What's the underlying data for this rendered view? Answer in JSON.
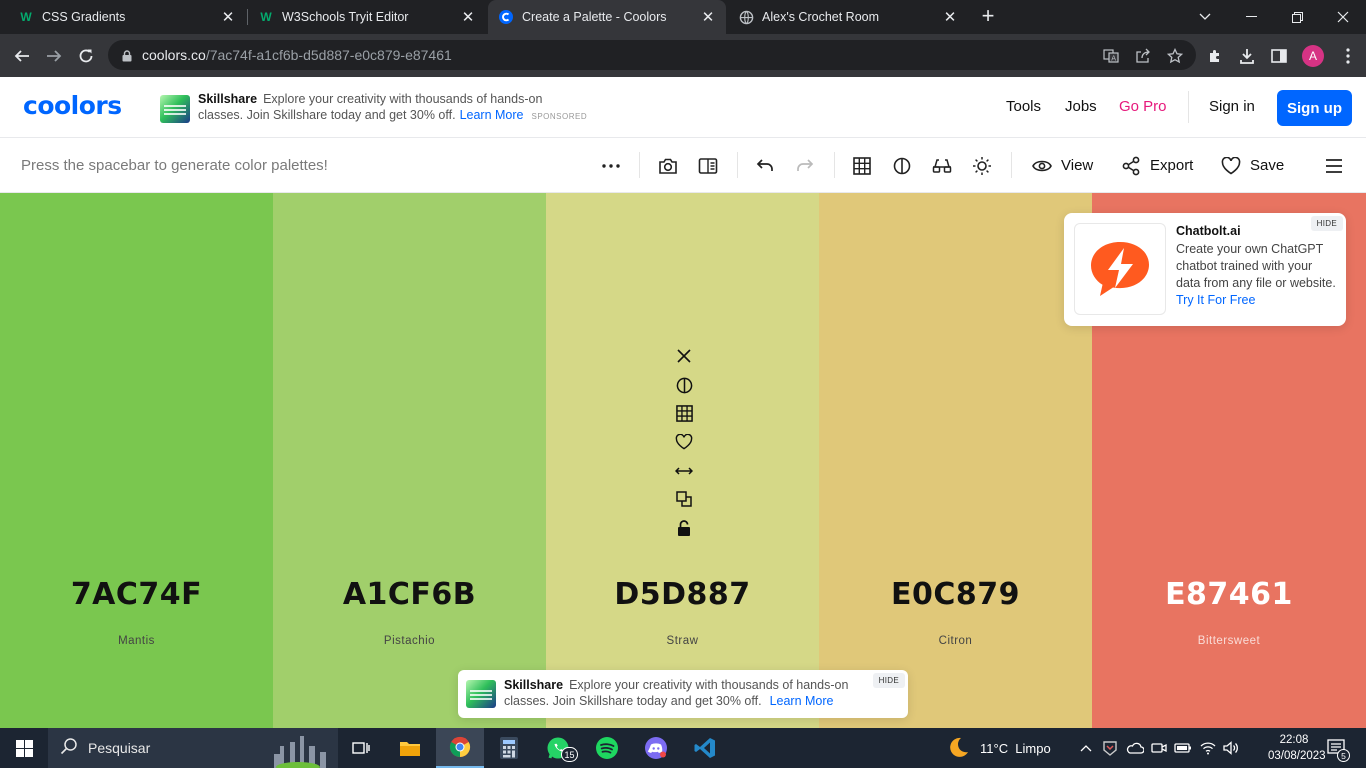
{
  "browser": {
    "tabs": [
      {
        "title": "CSS Gradients",
        "favicon": "w3schools-icon",
        "active": false
      },
      {
        "title": "W3Schools Tryit Editor",
        "favicon": "w3schools-icon",
        "active": false
      },
      {
        "title": "Create a Palette - Coolors",
        "favicon": "coolors-icon",
        "active": true
      },
      {
        "title": "Alex's Crochet Room",
        "favicon": "globe-icon",
        "active": false
      }
    ],
    "url_host": "coolors.co",
    "url_path": "/7ac74f-a1cf6b-d5d887-e0c879-e87461",
    "profile_initial": "A"
  },
  "header": {
    "logo": "coolors",
    "ad": {
      "brand": "Skillshare",
      "line1": "Explore your creativity with thousands of hands-on",
      "line2": "classes. Join Skillshare today and get 30% off.",
      "link": "Learn More",
      "sponsored": "SPONSORED"
    },
    "nav": {
      "tools": "Tools",
      "jobs": "Jobs",
      "go_pro": "Go Pro",
      "sign_in": "Sign in",
      "sign_up": "Sign up"
    }
  },
  "toolbar": {
    "hint": "Press the spacebar to generate color palettes!",
    "view_label": "View",
    "export_label": "Export",
    "save_label": "Save"
  },
  "palette": [
    {
      "hex": "7AC74F",
      "name": "Mantis",
      "color": "#7ac74f",
      "text": "dark"
    },
    {
      "hex": "A1CF6B",
      "name": "Pistachio",
      "color": "#a1cf6b",
      "text": "dark"
    },
    {
      "hex": "D5D887",
      "name": "Straw",
      "color": "#d5d887",
      "text": "dark"
    },
    {
      "hex": "E0C879",
      "name": "Citron",
      "color": "#e0c879",
      "text": "dark"
    },
    {
      "hex": "E87461",
      "name": "Bittersweet",
      "color": "#e87461",
      "text": "light"
    }
  ],
  "column_tools": [
    "close-icon",
    "contrast-icon",
    "shades-grid-icon",
    "heart-icon",
    "drag-arrows-icon",
    "copy-icon",
    "lock-icon"
  ],
  "chat_ad": {
    "hide": "HIDE",
    "title": "Chatbolt.ai",
    "body": "Create your own ChatGPT chatbot trained with your data from any file or website.",
    "link": "Try It For Free",
    "accent": "#ff5a1f"
  },
  "bottom_ad": {
    "hide": "HIDE",
    "brand": "Skillshare",
    "line1": "Explore your creativity with thousands of hands-on",
    "line2": "classes. Join Skillshare today and get 30% off.",
    "link": "Learn More"
  },
  "taskbar": {
    "search_placeholder": "Pesquisar",
    "whatsapp_badge": "15",
    "weather": "11°C  Limpo",
    "time": "22:08",
    "date": "03/08/2023",
    "notifications": "5"
  },
  "colors": {
    "brand": "#0066ff",
    "pro": "#e6197c",
    "chrome_dark": "#202124",
    "taskbar": "#1c2532"
  }
}
